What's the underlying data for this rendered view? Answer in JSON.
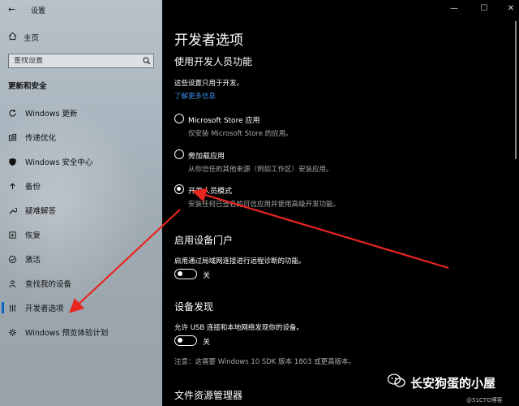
{
  "window": {
    "title": "设置",
    "back_glyph": "←",
    "min_glyph": "—",
    "max_glyph": "☐",
    "close_glyph": "✕"
  },
  "sidebar": {
    "home_label": "主页",
    "search_placeholder": "查找设置",
    "section_title": "更新和安全",
    "items": [
      {
        "label": "Windows 更新",
        "icon": "refresh-icon"
      },
      {
        "label": "传递优化",
        "icon": "delivery-icon"
      },
      {
        "label": "Windows 安全中心",
        "icon": "shield-icon"
      },
      {
        "label": "备份",
        "icon": "backup-icon"
      },
      {
        "label": "疑难解答",
        "icon": "wrench-icon"
      },
      {
        "label": "恢复",
        "icon": "recovery-icon"
      },
      {
        "label": "激活",
        "icon": "check-circle-icon"
      },
      {
        "label": "查找我的设备",
        "icon": "person-pin-icon"
      },
      {
        "label": "开发者选项",
        "icon": "developer-icon",
        "selected": true
      },
      {
        "label": "Windows 预览体验计划",
        "icon": "insider-icon"
      }
    ]
  },
  "main": {
    "title": "开发者选项",
    "dev_features": {
      "heading": "使用开发人员功能",
      "note": "这些设置只用于开发。",
      "learn_more": "了解更多信息",
      "options": [
        {
          "label": "Microsoft Store 应用",
          "desc": "仅安装 Microsoft Store 的应用。",
          "selected": false
        },
        {
          "label": "旁加载应用",
          "desc": "从你信任的其他来源（例如工作区）安装应用。",
          "selected": false
        },
        {
          "label": "开发人员模式",
          "desc": "安装任何已签名的可信应用并使用高级开发功能。",
          "selected": true
        }
      ]
    },
    "device_portal": {
      "heading": "启用设备门户",
      "desc": "启用通过局域网连接进行远程诊断的功能。",
      "toggle_state": "关"
    },
    "device_discovery": {
      "heading": "设备发现",
      "desc": "允许 USB 连接和本地网络发现你的设备。",
      "toggle_state": "关",
      "note": "注意：这需要 Windows 10 SDK 版本 1803 或更高版本。"
    },
    "file_explorer": {
      "heading": "文件资源管理器"
    }
  },
  "watermark": {
    "name": "长安狗蛋的小屋",
    "sub": "@51CTO博客"
  },
  "colors": {
    "accent": "#0a66c2",
    "link": "#3d8ee6",
    "annotation": "#e8251f"
  }
}
